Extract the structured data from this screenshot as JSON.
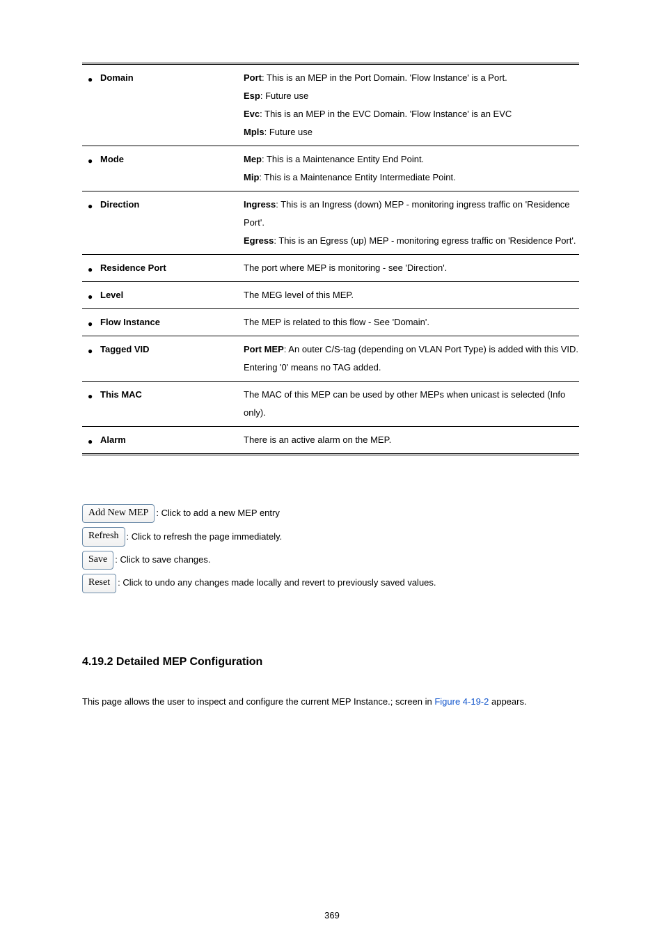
{
  "table": {
    "rows": [
      {
        "label": "Domain",
        "lines": [
          {
            "lead": "Port",
            "text": ": This is an MEP in the Port Domain. 'Flow Instance' is a Port."
          },
          {
            "lead": "Esp",
            "text": ": Future use"
          },
          {
            "lead": "Evc",
            "text": ": This is an MEP in the EVC Domain. 'Flow Instance' is an EVC"
          },
          {
            "lead": "Mpls",
            "text": ": Future use"
          }
        ]
      },
      {
        "label": "Mode",
        "lines": [
          {
            "lead": "Mep",
            "text": ": This is a Maintenance Entity End Point."
          },
          {
            "lead": "Mip",
            "text": ": This is a Maintenance Entity Intermediate Point."
          }
        ]
      },
      {
        "label": "Direction",
        "lines": [
          {
            "lead": "Ingress",
            "text": ": This is an Ingress (down) MEP - monitoring ingress traffic on 'Residence Port'."
          },
          {
            "lead": "Egress",
            "text": ": This is an Egress (up) MEP - monitoring egress traffic on 'Residence Port'."
          }
        ]
      },
      {
        "label": "Residence Port",
        "lines": [
          {
            "lead": "",
            "text": "The port where MEP is monitoring - see 'Direction'."
          }
        ]
      },
      {
        "label": "Level",
        "lines": [
          {
            "lead": "",
            "text": "The MEG level of this MEP."
          }
        ]
      },
      {
        "label": "Flow Instance",
        "lines": [
          {
            "lead": "",
            "text": "The MEP is related to this flow - See 'Domain'."
          }
        ]
      },
      {
        "label": "Tagged VID",
        "lines": [
          {
            "lead": "Port MEP",
            "text": ": An outer C/S-tag (depending on VLAN Port Type) is added with this VID."
          },
          {
            "lead": "",
            "text": "Entering '0' means no TAG added."
          }
        ]
      },
      {
        "label": "This MAC",
        "lines": [
          {
            "lead": "",
            "text": "The MAC of this MEP can be used by other MEPs when unicast is selected (Info only)."
          }
        ]
      },
      {
        "label": "Alarm",
        "lines": [
          {
            "lead": "",
            "text": "There is an active alarm on the MEP."
          }
        ]
      }
    ]
  },
  "buttons": [
    {
      "name": "add-new-mep-button",
      "label": "Add New MEP",
      "desc": ": Click to add a new MEP entry"
    },
    {
      "name": "refresh-button",
      "label": "Refresh",
      "desc": ": Click to refresh the page immediately."
    },
    {
      "name": "save-button",
      "label": "Save",
      "desc": ": Click to save changes."
    },
    {
      "name": "reset-button",
      "label": "Reset",
      "desc": ": Click to undo any changes made locally and revert to previously saved values."
    }
  ],
  "section": {
    "heading": "4.19.2 Detailed MEP Configuration",
    "intro_prefix": "This page allows the user to inspect and configure the current MEP Instance.; screen in ",
    "figref": "Figure 4-19-2",
    "intro_suffix": " appears."
  },
  "page_number": "369"
}
